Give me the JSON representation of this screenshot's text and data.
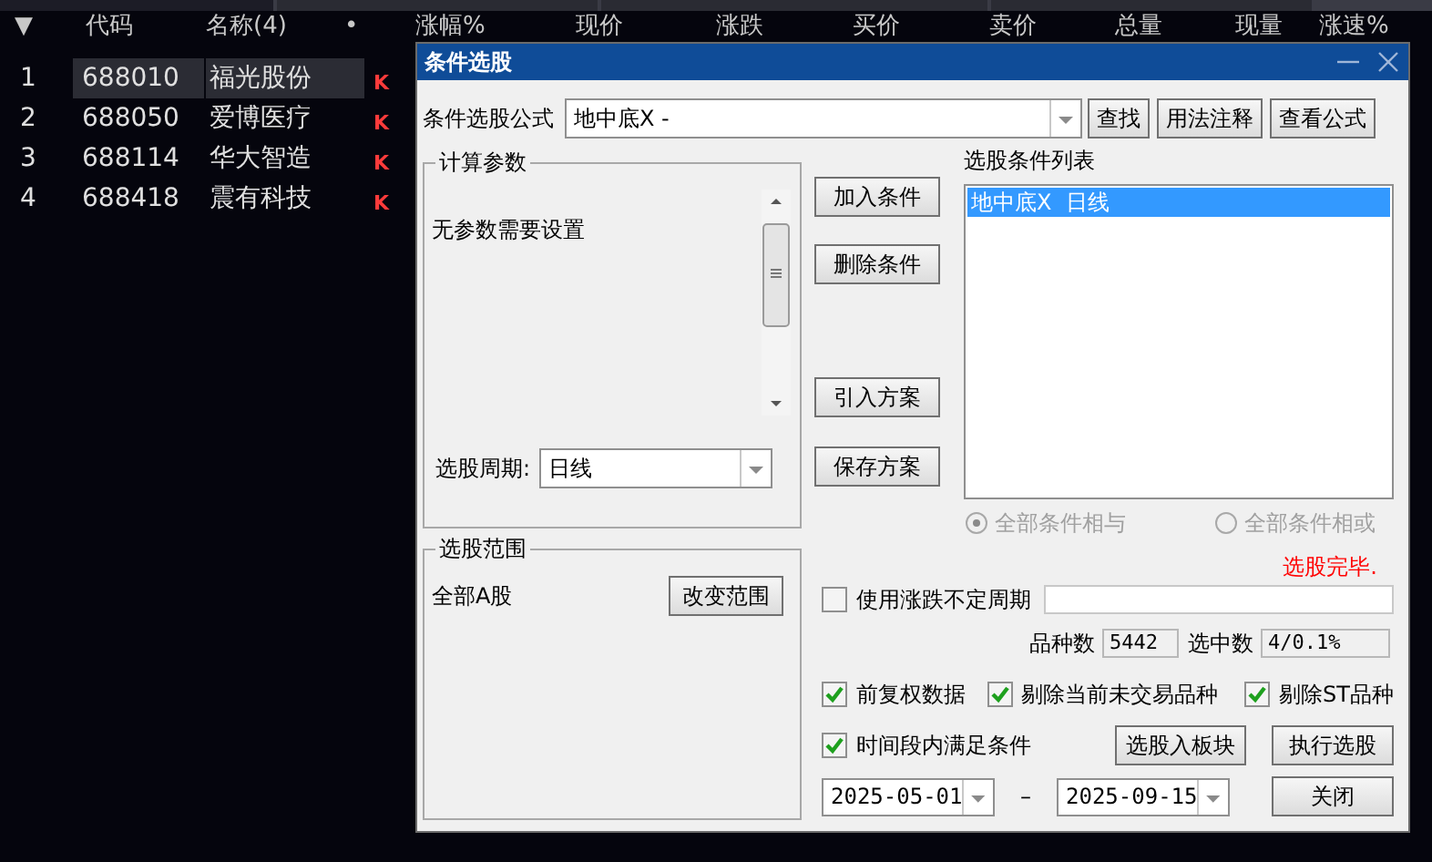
{
  "tabs": [
    {
      "selected": true
    },
    {
      "selected": false
    },
    {
      "selected": false
    },
    {
      "selected": false
    }
  ],
  "table": {
    "columns": [
      "▼",
      "代码",
      "名称(4)",
      "•",
      "涨幅%",
      "现价",
      "涨跌",
      "买价",
      "卖价",
      "总量",
      "现量",
      "涨速%"
    ],
    "rows": [
      {
        "index": "1",
        "code": "688010",
        "name": "福光股份",
        "flag": "K",
        "selected": true
      },
      {
        "index": "2",
        "code": "688050",
        "name": "爱博医疗",
        "flag": "K",
        "selected": false
      },
      {
        "index": "3",
        "code": "688114",
        "name": "华大智造",
        "flag": "K",
        "selected": false
      },
      {
        "index": "4",
        "code": "688418",
        "name": "震有科技",
        "flag": "K",
        "selected": false
      }
    ]
  },
  "dialog": {
    "title": "条件选股",
    "formula_label": "条件选股公式",
    "formula": "地中底X  -",
    "top_buttons": [
      "查找",
      "用法注释",
      "查看公式"
    ],
    "params_group": {
      "title": "计算参数",
      "message": "无参数需要设置",
      "period_label": "选股周期:",
      "period": "日线"
    },
    "side_buttons": [
      "加入条件",
      "删除条件",
      "引入方案",
      "保存方案"
    ],
    "conditions_label": "选股条件列表",
    "conditions": [
      {
        "text": "地中底X  日线",
        "selected": true
      }
    ],
    "logic": [
      {
        "label": "全部条件相与",
        "selected": true,
        "disabled": true
      },
      {
        "label": "全部条件相或",
        "selected": false,
        "disabled": true
      }
    ],
    "status": "选股完毕.",
    "range_group": {
      "title": "选股范围",
      "scope": "全部A股",
      "button": "改变范围"
    },
    "variable_period": {
      "label": "使用涨跌不定周期",
      "checked": false
    },
    "count_label": "品种数",
    "count": "5442",
    "selected_label": "选中数",
    "selected_count": "4/0.1%",
    "options": [
      {
        "label": "前复权数据",
        "checked": true
      },
      {
        "label": "剔除当前未交易品种",
        "checked": true
      },
      {
        "label": "剔除ST品种",
        "checked": true
      }
    ],
    "time_condition": {
      "label": "时间段内满足条件",
      "checked": true
    },
    "start_date": "2025-05-01",
    "date_separator": "–",
    "end_date": "2025-09-15",
    "action_buttons": [
      "选股入板块",
      "执行选股",
      "关闭"
    ]
  }
}
